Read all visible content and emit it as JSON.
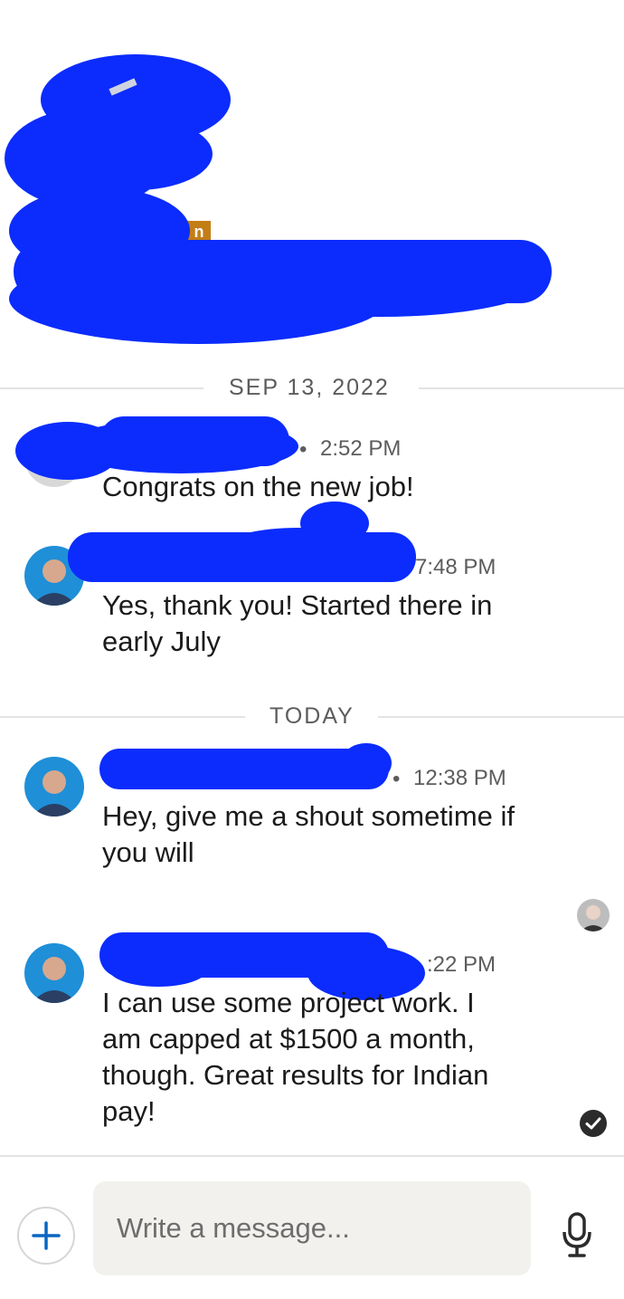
{
  "header": {
    "badge_text": "n"
  },
  "conversation": {
    "date_dividers": [
      "SEP 13, 2022",
      "TODAY"
    ],
    "messages": [
      {
        "time": "2:52 PM",
        "text": "Congrats on the new job!"
      },
      {
        "time": "7:48 PM",
        "text_lines": [
          "Yes, thank you! Started there in",
          "early July"
        ]
      },
      {
        "time": "12:38 PM",
        "text_lines": [
          "Hey, give me a shout sometime if",
          "you will"
        ]
      },
      {
        "time": ":22 PM",
        "text_lines": [
          "I can use some project work. I",
          "am capped at $1500  a month,",
          "though. Great results for Indian",
          "pay!"
        ]
      }
    ],
    "first_message_badge": "n",
    "separator_dot": "•"
  },
  "composer": {
    "placeholder": "Write a message..."
  },
  "colors": {
    "redaction": "#0b2cfd",
    "accent_blue": "#0a66c2",
    "badge_gold": "#c37d16",
    "avatar_bg": "#1f8fd8"
  },
  "icons": {
    "add": "plus-icon",
    "mic": "microphone-icon",
    "read_receipt": "check-circle-icon",
    "seen_avatar": "avatar"
  }
}
